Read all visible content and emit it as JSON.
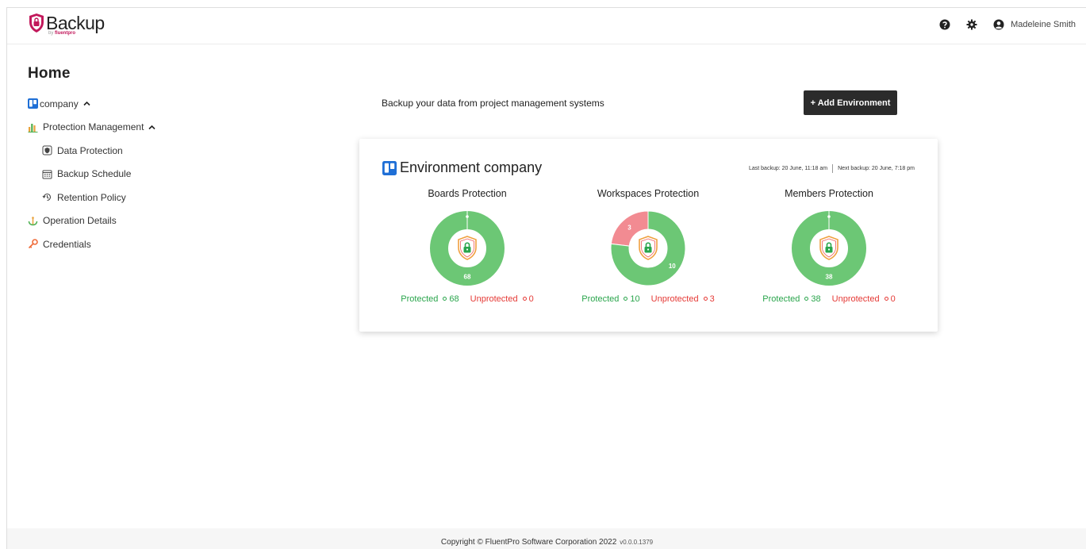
{
  "header": {
    "logo_text": "Backup",
    "logo_sub_prefix": "by ",
    "logo_sub_brand": "fluentpro",
    "user_name": "Madeleine Smith"
  },
  "sidebar": {
    "title": "Home",
    "items": [
      {
        "label": "company"
      },
      {
        "label": "Protection Management"
      },
      {
        "label": "Data Protection"
      },
      {
        "label": "Backup Schedule"
      },
      {
        "label": "Retention Policy"
      },
      {
        "label": "Operation Details"
      },
      {
        "label": "Credentials"
      }
    ]
  },
  "main": {
    "tagline": "Backup your data from project management systems",
    "add_button": "+ Add Environment"
  },
  "card": {
    "title": "Environment company",
    "last_backup": "Last backup: 20 June, 11:18 am",
    "next_backup": "Next backup: 20 June, 7:18 pm",
    "panels": [
      {
        "title": "Boards Protection",
        "protected_label": "Protected",
        "protected": 68,
        "unprotected_label": "Unprotected",
        "unprotected": 0
      },
      {
        "title": "Workspaces Protection",
        "protected_label": "Protected",
        "protected": 10,
        "unprotected_label": "Unprotected",
        "unprotected": 3
      },
      {
        "title": "Members Protection",
        "protected_label": "Protected",
        "protected": 38,
        "unprotected_label": "Unprotected",
        "unprotected": 0
      }
    ]
  },
  "colors": {
    "protected": "#6cc775",
    "unprotected": "#f28b92",
    "accent_dark": "#2b2b2b",
    "trello_blue": "#1f6fd6"
  },
  "footer": {
    "copyright": "Copyright © FluentPro Software Corporation 2022",
    "version": "v0.0.0.1379"
  }
}
